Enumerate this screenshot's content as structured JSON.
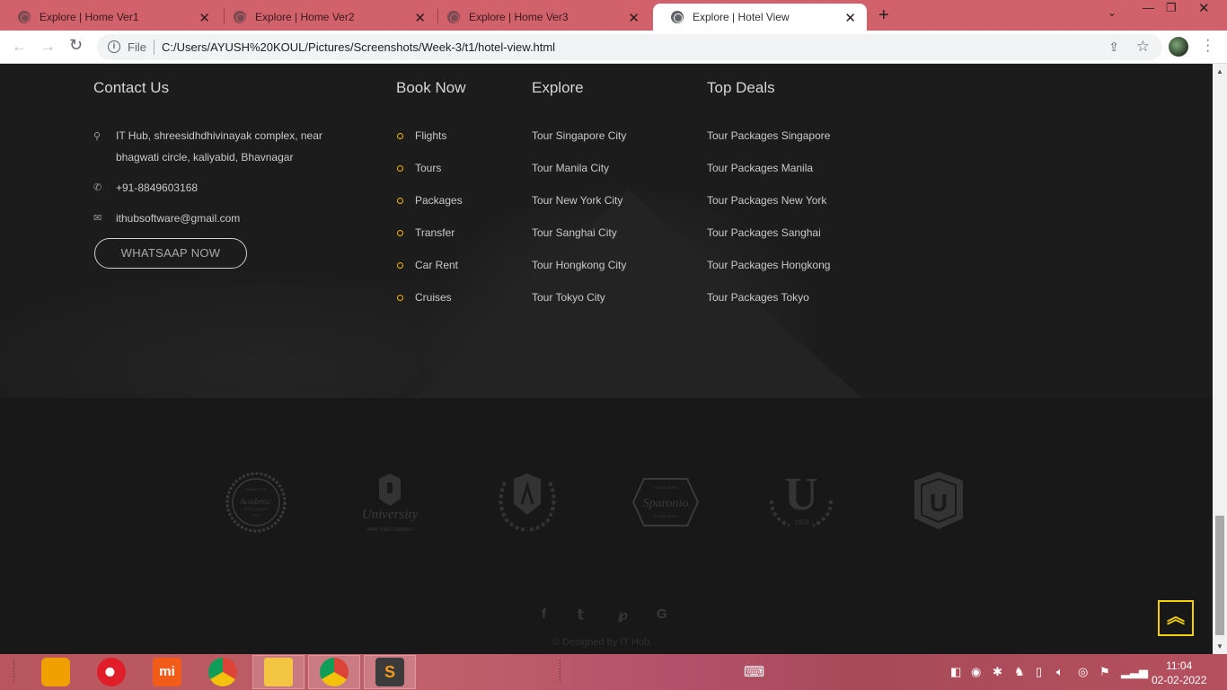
{
  "browser": {
    "tabs": [
      {
        "label": "Explore | Home Ver1",
        "active": false
      },
      {
        "label": "Explore | Home Ver2",
        "active": false
      },
      {
        "label": "Explore | Home Ver3",
        "active": false
      },
      {
        "label": "Explore | Hotel View",
        "active": true
      }
    ],
    "scheme_label": "File",
    "url": "C:/Users/AYUSH%20KOUL/Pictures/Screenshots/Week-3/t1/hotel-view.html"
  },
  "footer": {
    "contact": {
      "title": "Contact Us",
      "address_line1": "IT Hub, shreesidhdhivinayak complex, near",
      "address_line2": "bhagwati circle, kaliyabid, Bhavnagar",
      "phone": "+91-8849603168",
      "email": "ithubsoftware@gmail.com",
      "whatsapp_button": "WHATSAAP NOW"
    },
    "book_now": {
      "title": "Book Now",
      "items": [
        "Flights",
        "Tours",
        "Packages",
        "Transfer",
        "Car Rent",
        "Cruises"
      ]
    },
    "explore": {
      "title": "Explore",
      "items": [
        "Tour Singapore City",
        "Tour Manila City",
        "Tour New York City",
        "Tour Sanghai City",
        "Tour Hongkong City",
        "Tour Tokyo City"
      ]
    },
    "top_deals": {
      "title": "Top Deals",
      "items": [
        "Tour Packages Singapore",
        "Tour Packages Manila",
        "Tour Packages New York",
        "Tour Packages Sanghai",
        "Tour Packages Hongkong",
        "Tour Packages Tokyo"
      ]
    },
    "logos": {
      "academic_small": "AWARD FOR",
      "academic_main": "Academic",
      "academic_sub": "EXCELLENCE",
      "academic_year": "2013",
      "university_script": "University",
      "university_sub": "NEW YORK CAMPUS",
      "sparonio_top": "ESTABLISHED",
      "sparonio": "Sparonio",
      "sparonio_bottom": "ESTABLISHED",
      "u_letter": "U",
      "u_year": "1953",
      "shield_letter": "U"
    },
    "social_icons": [
      "facebook-icon",
      "twitter-icon",
      "pinterest-icon",
      "google-icon"
    ],
    "copyright": "© Designed by IT Hub.",
    "back_to_top_icon": "double-chevron-up-icon"
  },
  "taskbar": {
    "time": "11:04",
    "date": "02-02-2022"
  },
  "colors": {
    "accent": "#f4b400",
    "tabstrip": "#d1616a",
    "footer_bg": "#1a1a1a"
  }
}
